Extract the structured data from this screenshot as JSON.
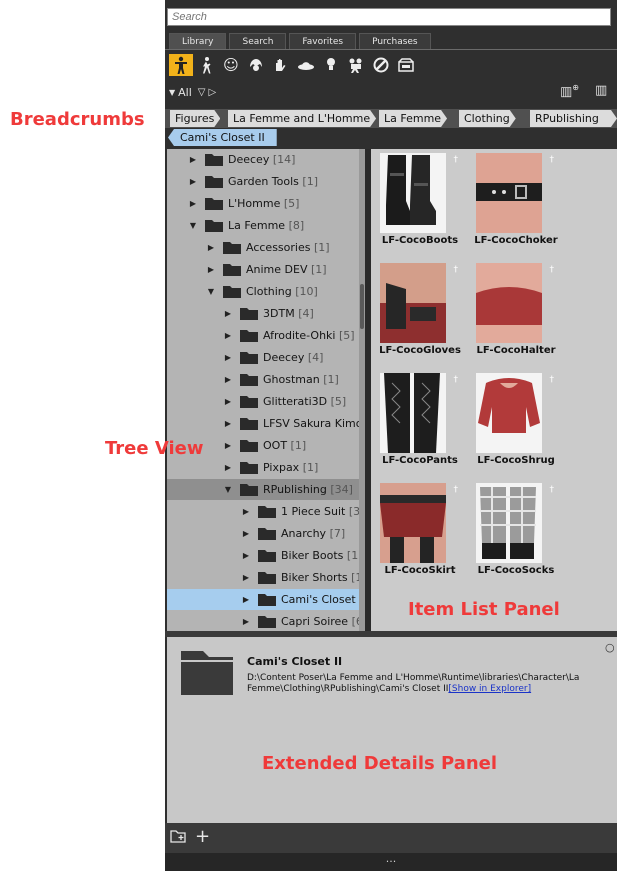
{
  "search": {
    "placeholder": "Search"
  },
  "tabs": [
    "Library",
    "Search",
    "Favorites",
    "Purchases"
  ],
  "filters": {
    "all_label": "All"
  },
  "breadcrumbs": [
    "Figures",
    "La Femme and L'Homme",
    "La Femme",
    "Clothing",
    "RPublishing"
  ],
  "current_crumb": "Cami's Closet II",
  "tree": [
    {
      "label": "Deecey",
      "count": "[14]"
    },
    {
      "label": "Garden Tools",
      "count": "[1]"
    },
    {
      "label": "L'Homme",
      "count": "[5]"
    },
    {
      "label": "La Femme",
      "count": "[8]"
    },
    {
      "label": "Accessories",
      "count": "[1]"
    },
    {
      "label": "Anime DEV",
      "count": "[1]"
    },
    {
      "label": "Clothing",
      "count": "[10]"
    },
    {
      "label": "3DTM",
      "count": "[4]"
    },
    {
      "label": "Afrodite-Ohki",
      "count": "[5]"
    },
    {
      "label": "Deecey",
      "count": "[4]"
    },
    {
      "label": "Ghostman",
      "count": "[1]"
    },
    {
      "label": "Glitterati3D",
      "count": "[5]"
    },
    {
      "label": "LFSV Sakura Kimo",
      "count": ""
    },
    {
      "label": "OOT",
      "count": "[1]"
    },
    {
      "label": "Pixpax",
      "count": "[1]"
    },
    {
      "label": "RPublishing",
      "count": "[34]"
    },
    {
      "label": "1 Piece Suit",
      "count": "[3"
    },
    {
      "label": "Anarchy",
      "count": "[7]"
    },
    {
      "label": "Biker Boots",
      "count": "[1]"
    },
    {
      "label": "Biker Shorts",
      "count": "[1"
    },
    {
      "label": "Cami's Closet",
      "count": ""
    },
    {
      "label": "Capri Soiree",
      "count": "[6"
    }
  ],
  "items": [
    "LF-CocoBoots",
    "LF-CocoChoker",
    "LF-CocoGloves",
    "LF-CocoHalter",
    "LF-CocoPants",
    "LF-CocoShrug",
    "LF-CocoSkirt",
    "LF-CocoSocks"
  ],
  "details": {
    "title": "Cami's Closet II",
    "path": "D:\\Content Poser\\La Femme and L'Homme\\Runtime\\libraries\\Character\\La Femme\\Clothing\\RPublishing\\Cami's Closet II",
    "link": "[Show in Explorer]"
  },
  "status": "...",
  "annotations": {
    "breadcrumbs": "Breadcrumbs",
    "tree_view": "Tree View",
    "item_list": "Item List Panel",
    "extended_details": "Extended Details Panel"
  },
  "colors": {
    "annotation": "#ef3a3a",
    "selected_filter": "#f2b21a",
    "selected_row": "#a6cdee",
    "link": "#1a33c8"
  }
}
